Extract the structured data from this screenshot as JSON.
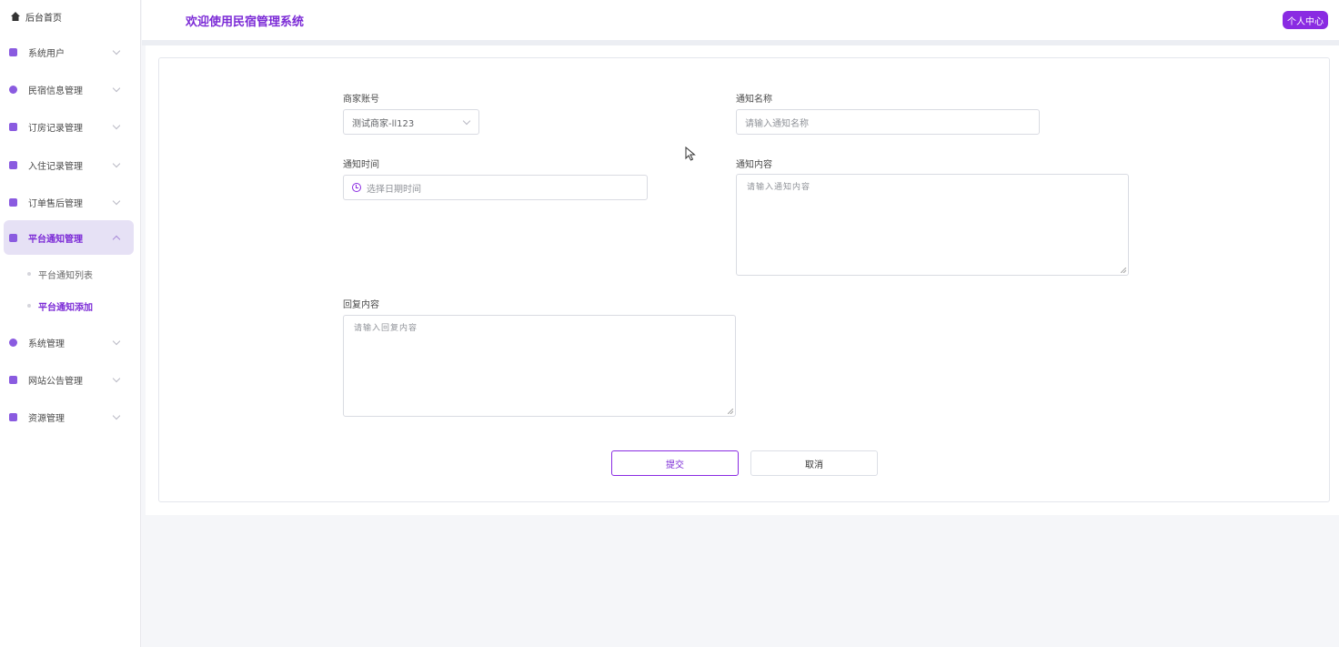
{
  "sidebar": {
    "home": "后台首页",
    "items": [
      {
        "label": "系统用户",
        "icon": "user-icon",
        "color": "#8a5be0"
      },
      {
        "label": "民宿信息管理",
        "icon": "location-icon",
        "color": "#8a5be0"
      },
      {
        "label": "订房记录管理",
        "icon": "doc-icon",
        "color": "#8a5be0"
      },
      {
        "label": "入住记录管理",
        "icon": "box-icon",
        "color": "#8a5be0"
      },
      {
        "label": "订单售后管理",
        "icon": "doc-edit-icon",
        "color": "#8a5be0"
      },
      {
        "label": "平台通知管理",
        "icon": "notice-icon",
        "color": "#8a5be0"
      },
      {
        "label": "系统管理",
        "icon": "location-icon",
        "color": "#8a5be0"
      },
      {
        "label": "网站公告管理",
        "icon": "list-icon",
        "color": "#8a5be0"
      },
      {
        "label": "资源管理",
        "icon": "doc-icon",
        "color": "#8a5be0"
      }
    ],
    "subitems": [
      "平台通知列表",
      "平台通知添加"
    ]
  },
  "header": {
    "title": "欢迎使用民宿管理系统",
    "user_button": "个人中心"
  },
  "form": {
    "merchant_label": "商家账号",
    "merchant_value": "测试商家-ll123",
    "name_label": "通知名称",
    "name_placeholder": "请输入通知名称",
    "time_label": "通知时间",
    "time_placeholder": "选择日期时间",
    "content_label": "通知内容",
    "content_placeholder": "请输入通知内容",
    "reply_label": "回复内容",
    "reply_placeholder": "请输入回复内容",
    "submit": "提交",
    "cancel": "取消"
  },
  "colors": {
    "accent": "#8a2be2",
    "accent_text": "#7b2ad6"
  }
}
